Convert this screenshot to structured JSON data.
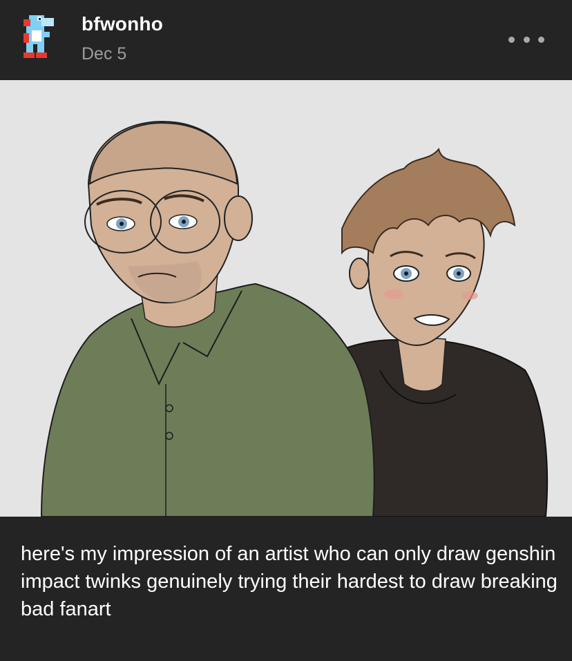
{
  "post": {
    "avatar_icon": "blue-yoshi-icon",
    "username": "bfwonho",
    "date": "Dec 5",
    "menu_icon": "more-options-icon",
    "caption": "here's my impression of an artist who can only draw genshin impact twinks genuinely trying their hardest to draw breaking bad fanart"
  },
  "colors": {
    "background": "#242424",
    "artwork_background": "#e4e4e4",
    "shirt_green": "#6d7d58",
    "hoodie_black": "#2f2a28",
    "skin": "#d2b196",
    "hair_brown": "#a47d5c"
  }
}
